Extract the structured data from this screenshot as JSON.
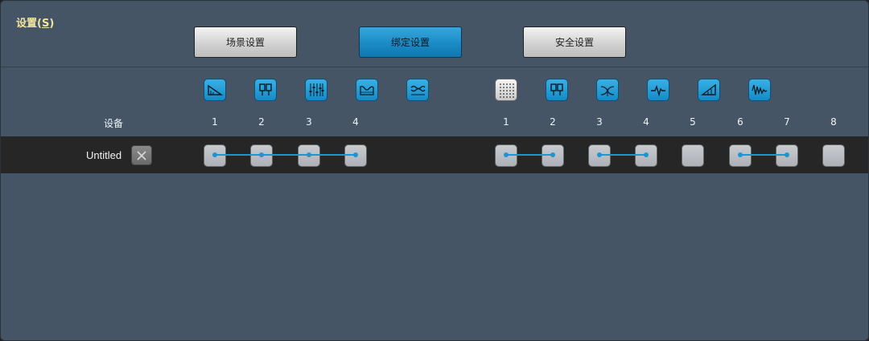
{
  "window": {
    "title": "设置(S)",
    "title_main": "设置(",
    "title_key": "S",
    "title_end": ")"
  },
  "tabs": [
    {
      "label": "场景设置",
      "active": false
    },
    {
      "label": "绑定设置",
      "active": true
    },
    {
      "label": "安全设置",
      "active": false
    }
  ],
  "device_header": "设备",
  "group1": {
    "icons": [
      "room-correction-icon",
      "speaker-position-icon",
      "mixer-sliders-icon",
      "frequency-curve-icon",
      "equalizer-wave-icon"
    ],
    "channels": [
      "1",
      "2",
      "3",
      "4"
    ]
  },
  "group2": {
    "icons": [
      "dot-grid-icon",
      "speaker-position-icon",
      "crossover-icon",
      "heartbeat-wave-icon",
      "volume-ramp-icon",
      "oscillation-wave-icon"
    ],
    "channels": [
      "1",
      "2",
      "3",
      "4",
      "5",
      "6",
      "7",
      "8"
    ]
  },
  "device": {
    "name": "Untitled"
  },
  "colors": {
    "accent": "#1a95d6",
    "background": "#465565",
    "row": "#262626",
    "title": "#f0e4a0"
  }
}
